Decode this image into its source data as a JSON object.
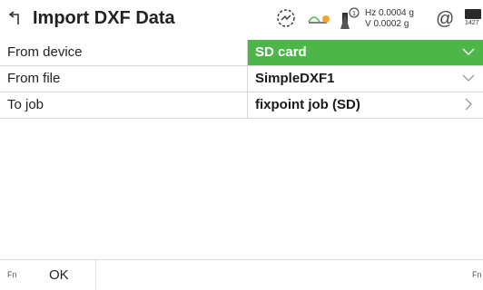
{
  "titlebar": {
    "title": "Import DXF Data",
    "hz_label": "Hz 0.0004 g",
    "v_label": "V  0.0002 g",
    "at_symbol": "@",
    "battery_text": "1427"
  },
  "form": {
    "rows": [
      {
        "label": "From device",
        "value": "SD card",
        "active": true,
        "control": "dropdown"
      },
      {
        "label": "From file",
        "value": "SimpleDXF1",
        "active": false,
        "control": "dropdown"
      },
      {
        "label": "To job",
        "value": "fixpoint job (SD)",
        "active": false,
        "control": "navigate"
      }
    ]
  },
  "softkeys": {
    "fn_left": "Fn",
    "ok_label": "OK",
    "fn_right": "Fn"
  },
  "colors": {
    "accent_green": "#4cb748",
    "divider": "#d6d6d6"
  },
  "icons": {
    "back": "back-arrow-icon",
    "gnss": "gnss-globe-icon",
    "prism": "prism-icon",
    "level": "level-bubble-icon",
    "battery": "battery-icon",
    "dropdown": "chevron-down-icon",
    "navigate": "chevron-right-icon"
  }
}
